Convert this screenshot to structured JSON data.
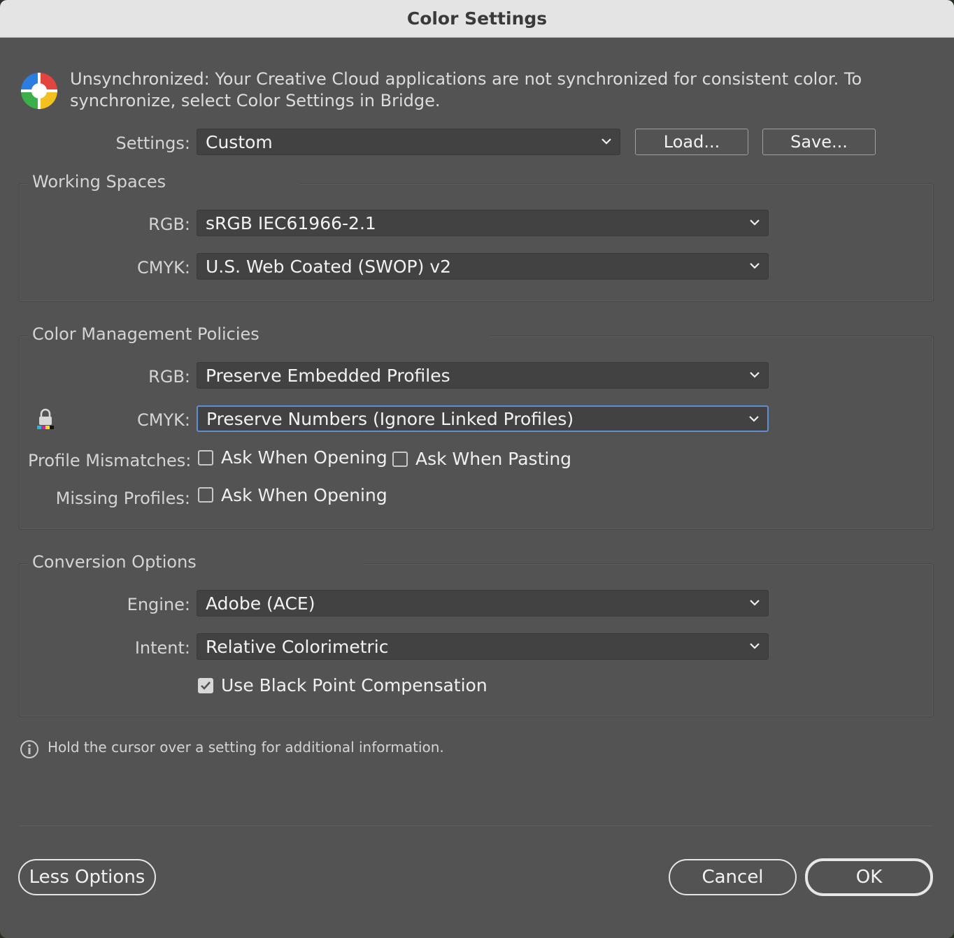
{
  "window": {
    "title": "Color Settings"
  },
  "sync_message": {
    "line1": "Unsynchronized: Your Creative Cloud applications are not synchronized for consistent color. To",
    "line2": "synchronize, select Color Settings in Bridge."
  },
  "settings": {
    "label": "Settings:",
    "value": "Custom",
    "load_label": "Load...",
    "save_label": "Save..."
  },
  "working_spaces": {
    "title": "Working Spaces",
    "rgb_label": "RGB:",
    "rgb_value": "sRGB IEC61966-2.1",
    "cmyk_label": "CMYK:",
    "cmyk_value": "U.S. Web Coated (SWOP) v2"
  },
  "policies": {
    "title": "Color Management Policies",
    "rgb_label": "RGB:",
    "rgb_value": "Preserve Embedded Profiles",
    "cmyk_label": "CMYK:",
    "cmyk_value": "Preserve Numbers (Ignore Linked Profiles)",
    "mismatch_label": "Profile Mismatches:",
    "mismatch_opening": {
      "label": "Ask When Opening",
      "checked": false
    },
    "mismatch_pasting": {
      "label": "Ask When Pasting",
      "checked": false
    },
    "missing_label": "Missing Profiles:",
    "missing_opening": {
      "label": "Ask When Opening",
      "checked": false
    }
  },
  "conversion": {
    "title": "Conversion Options",
    "engine_label": "Engine:",
    "engine_value": "Adobe (ACE)",
    "intent_label": "Intent:",
    "intent_value": "Relative Colorimetric",
    "bpc": {
      "label": "Use Black Point Compensation",
      "checked": true
    }
  },
  "info_text": "Hold the cursor over a setting for additional information.",
  "footer": {
    "less_options_label": "Less Options",
    "cancel_label": "Cancel",
    "ok_label": "OK"
  },
  "icons": {
    "sync": "color-wheel-icon",
    "lock": "lock-icon",
    "info": "info-icon",
    "chevron": "chevron-down-icon"
  },
  "colors": {
    "focus": "#5f8fd0",
    "background": "#535353",
    "titlebar": "#e4e4e4"
  }
}
